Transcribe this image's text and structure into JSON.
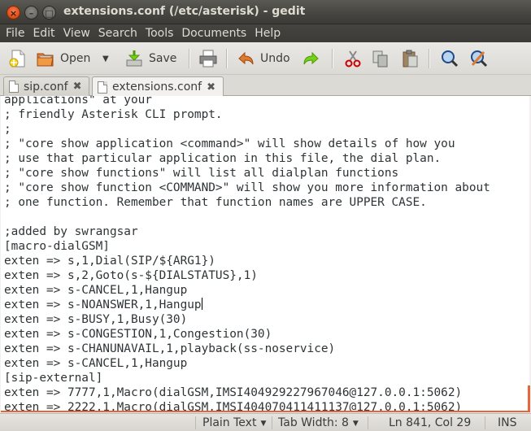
{
  "window": {
    "title": "extensions.conf (/etc/asterisk) - gedit"
  },
  "menubar": [
    "File",
    "Edit",
    "View",
    "Search",
    "Tools",
    "Documents",
    "Help"
  ],
  "toolbar": {
    "open_label": "Open",
    "save_label": "Save",
    "undo_label": "Undo"
  },
  "tabs": [
    {
      "label": "sip.conf",
      "active": false
    },
    {
      "label": "extensions.conf",
      "active": true
    }
  ],
  "editor": {
    "lines": [
      "applications\" at your",
      "; friendly Asterisk CLI prompt.",
      ";",
      "; \"core show application <command>\" will show details of how you",
      "; use that particular application in this file, the dial plan.",
      "; \"core show functions\" will list all dialplan functions",
      "; \"core show function <COMMAND>\" will show you more information about",
      "; one function. Remember that function names are UPPER CASE.",
      "",
      ";added by swrangsar",
      "[macro-dialGSM]",
      "exten => s,1,Dial(SIP/${ARG1})",
      "exten => s,2,Goto(s-${DIALSTATUS},1)",
      "exten => s-CANCEL,1,Hangup",
      "exten => s-NOANSWER,1,Hangup",
      "exten => s-BUSY,1,Busy(30)",
      "exten => s-CONGESTION,1,Congestion(30)",
      "exten => s-CHANUNAVAIL,1,playback(ss-noservice)",
      "exten => s-CANCEL,1,Hangup",
      "[sip-external]",
      "exten => 7777,1,Macro(dialGSM,IMSI404929227967046@127.0.0.1:5062)",
      "exten => 2222,1,Macro(dialGSM,IMSI404070411411137@127.0.0.1:5062)"
    ],
    "caret_line": 14
  },
  "statusbar": {
    "language": "Plain Text",
    "tab_width": "Tab Width: 8",
    "position": "Ln 841, Col 29",
    "mode": "INS"
  },
  "colors": {
    "accent": "#e8643a",
    "titlebar": "#3c3b37"
  },
  "icons": [
    "close-icon",
    "minimize-icon",
    "maximize-icon",
    "new-document-icon",
    "open-folder-icon",
    "dropdown-arrow-icon",
    "save-icon",
    "print-icon",
    "undo-icon",
    "redo-icon",
    "cut-icon",
    "copy-icon",
    "paste-icon",
    "search-icon",
    "replace-icon",
    "document-icon",
    "tab-close-icon"
  ]
}
